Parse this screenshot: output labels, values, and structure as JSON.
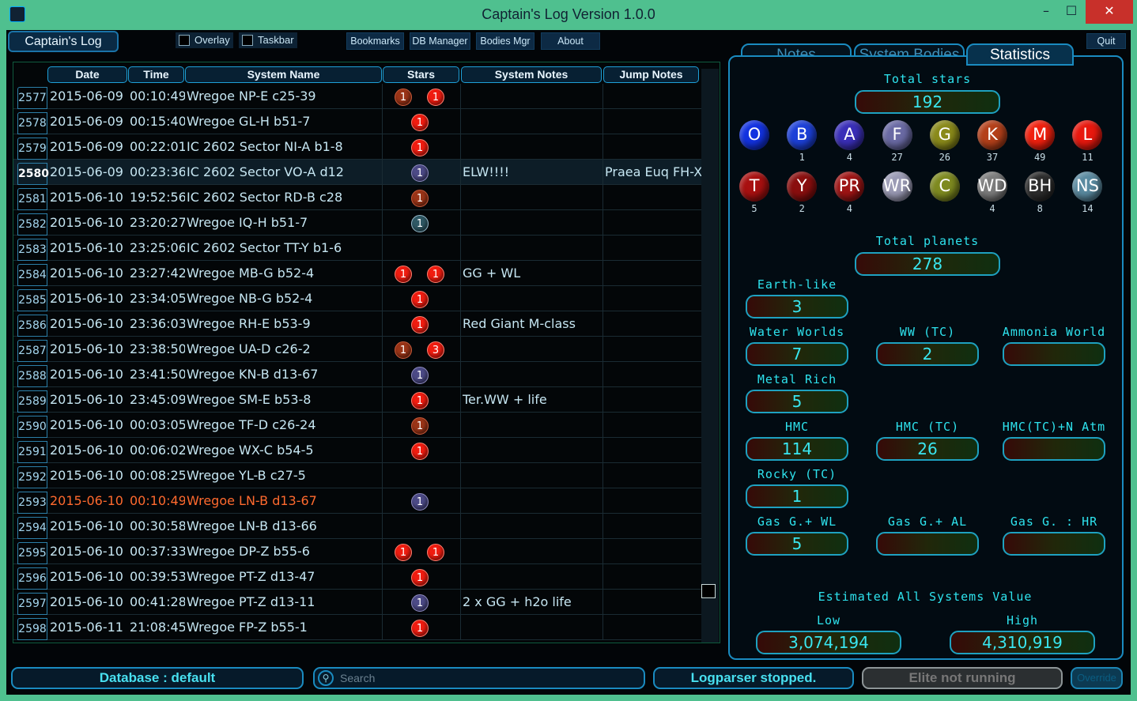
{
  "window": {
    "title": "Captain's Log Version 1.0.0",
    "min": "–",
    "max": "☐",
    "close": "✕"
  },
  "toolbar": {
    "app_label": "Captain's Log",
    "overlay": "Overlay",
    "taskbar": "Taskbar",
    "bookmarks": "Bookmarks",
    "db_manager": "DB Manager",
    "bodies_mgr": "Bodies Mgr",
    "about": "About",
    "quit": "Quit"
  },
  "grid": {
    "columns": [
      "Date",
      "Time",
      "System Name",
      "Stars",
      "System Notes",
      "Jump Notes"
    ],
    "rows": [
      {
        "id": "2577",
        "date": "2015-06-09",
        "time": "00:10:49",
        "name": "Wregoe NP-E c25-39",
        "stars": [
          {
            "n": "1",
            "c": "brown"
          },
          {
            "n": "1",
            "c": "red"
          }
        ],
        "notes": "",
        "jump": ""
      },
      {
        "id": "2578",
        "date": "2015-06-09",
        "time": "00:15:40",
        "name": "Wregoe GL-H b51-7",
        "stars": [
          {
            "n": "1",
            "c": "red"
          }
        ],
        "notes": "",
        "jump": ""
      },
      {
        "id": "2579",
        "date": "2015-06-09",
        "time": "00:22:01",
        "name": "IC 2602 Sector NI-A b1-8",
        "stars": [
          {
            "n": "1",
            "c": "red"
          }
        ],
        "notes": "",
        "jump": ""
      },
      {
        "id": "2580",
        "date": "2015-06-09",
        "time": "00:23:36",
        "name": "IC 2602 Sector VO-A d12",
        "stars": [
          {
            "n": "1",
            "c": "violet"
          }
        ],
        "notes": "ELW!!!!",
        "jump": "Praea Euq FH-X"
      },
      {
        "id": "2581",
        "date": "2015-06-10",
        "time": "19:52:56",
        "name": "IC 2602 Sector RD-B c28",
        "stars": [
          {
            "n": "1",
            "c": "brown"
          }
        ],
        "notes": "",
        "jump": ""
      },
      {
        "id": "2582",
        "date": "2015-06-10",
        "time": "23:20:27",
        "name": "Wregoe IQ-H b51-7",
        "stars": [
          {
            "n": "1",
            "c": "teal"
          }
        ],
        "notes": "",
        "jump": ""
      },
      {
        "id": "2583",
        "date": "2015-06-10",
        "time": "23:25:06",
        "name": "IC 2602 Sector TT-Y b1-6",
        "stars": [],
        "notes": "",
        "jump": ""
      },
      {
        "id": "2584",
        "date": "2015-06-10",
        "time": "23:27:42",
        "name": "Wregoe MB-G b52-4",
        "stars": [
          {
            "n": "1",
            "c": "red"
          },
          {
            "n": "1",
            "c": "red"
          }
        ],
        "notes": "GG + WL",
        "jump": ""
      },
      {
        "id": "2585",
        "date": "2015-06-10",
        "time": "23:34:05",
        "name": "Wregoe NB-G b52-4",
        "stars": [
          {
            "n": "1",
            "c": "red"
          }
        ],
        "notes": "",
        "jump": ""
      },
      {
        "id": "2586",
        "date": "2015-06-10",
        "time": "23:36:03",
        "name": "Wregoe RH-E b53-9",
        "stars": [
          {
            "n": "1",
            "c": "red"
          }
        ],
        "notes": "Red Giant M-class",
        "jump": ""
      },
      {
        "id": "2587",
        "date": "2015-06-10",
        "time": "23:38:50",
        "name": "Wregoe UA-D c26-2",
        "stars": [
          {
            "n": "1",
            "c": "brown"
          },
          {
            "n": "3",
            "c": "red"
          }
        ],
        "notes": "",
        "jump": ""
      },
      {
        "id": "2588",
        "date": "2015-06-10",
        "time": "23:41:50",
        "name": "Wregoe KN-B d13-67",
        "stars": [
          {
            "n": "1",
            "c": "violet"
          }
        ],
        "notes": "",
        "jump": ""
      },
      {
        "id": "2589",
        "date": "2015-06-10",
        "time": "23:45:09",
        "name": "Wregoe SM-E b53-8",
        "stars": [
          {
            "n": "1",
            "c": "red"
          }
        ],
        "notes": "Ter.WW + life",
        "jump": ""
      },
      {
        "id": "2590",
        "date": "2015-06-10",
        "time": "00:03:05",
        "name": "Wregoe TF-D c26-24",
        "stars": [
          {
            "n": "1",
            "c": "brown"
          }
        ],
        "notes": "",
        "jump": ""
      },
      {
        "id": "2591",
        "date": "2015-06-10",
        "time": "00:06:02",
        "name": "Wregoe WX-C b54-5",
        "stars": [
          {
            "n": "1",
            "c": "red"
          }
        ],
        "notes": "",
        "jump": ""
      },
      {
        "id": "2592",
        "date": "2015-06-10",
        "time": "00:08:25",
        "name": "Wregoe YL-B c27-5",
        "stars": [],
        "notes": "",
        "jump": ""
      },
      {
        "id": "2593",
        "date": "2015-06-10",
        "time": "00:10:49",
        "name": "Wregoe LN-B d13-67",
        "stars": [
          {
            "n": "1",
            "c": "violet"
          }
        ],
        "notes": "",
        "jump": "",
        "alert": true
      },
      {
        "id": "2594",
        "date": "2015-06-10",
        "time": "00:30:58",
        "name": "Wregoe LN-B d13-66",
        "stars": [],
        "notes": "",
        "jump": ""
      },
      {
        "id": "2595",
        "date": "2015-06-10",
        "time": "00:37:33",
        "name": "Wregoe DP-Z b55-6",
        "stars": [
          {
            "n": "1",
            "c": "red"
          },
          {
            "n": "1",
            "c": "red"
          }
        ],
        "notes": "",
        "jump": ""
      },
      {
        "id": "2596",
        "date": "2015-06-10",
        "time": "00:39:53",
        "name": "Wregoe PT-Z d13-47",
        "stars": [
          {
            "n": "1",
            "c": "red"
          }
        ],
        "notes": "",
        "jump": ""
      },
      {
        "id": "2597",
        "date": "2015-06-10",
        "time": "00:41:28",
        "name": "Wregoe PT-Z d13-11",
        "stars": [
          {
            "n": "1",
            "c": "violet"
          }
        ],
        "notes": "2 x GG + h2o life",
        "jump": ""
      },
      {
        "id": "2598",
        "date": "2015-06-11",
        "time": "21:08:45",
        "name": "Wregoe FP-Z b55-1",
        "stars": [
          {
            "n": "1",
            "c": "red"
          }
        ],
        "notes": "",
        "jump": ""
      }
    ]
  },
  "tabs": {
    "notes": "Notes",
    "bodies": "System Bodies",
    "stats": "Statistics"
  },
  "stats": {
    "total_stars_label": "Total stars",
    "total_stars": "192",
    "star_classes": [
      {
        "cls": "O",
        "count": "",
        "color": "#1232e0"
      },
      {
        "cls": "B",
        "count": "1",
        "color": "#1c40d8"
      },
      {
        "cls": "A",
        "count": "4",
        "color": "#3a2fb8"
      },
      {
        "cls": "F",
        "count": "27",
        "color": "#6a6aa4"
      },
      {
        "cls": "G",
        "count": "26",
        "color": "#8a8a1a"
      },
      {
        "cls": "K",
        "count": "37",
        "color": "#b4401a"
      },
      {
        "cls": "M",
        "count": "49",
        "color": "#f0200e"
      },
      {
        "cls": "L",
        "count": "11",
        "color": "#e8180e"
      },
      {
        "cls": "T",
        "count": "5",
        "color": "#a81010"
      },
      {
        "cls": "Y",
        "count": "2",
        "color": "#8a0e0e"
      },
      {
        "cls": "PR",
        "count": "4",
        "color": "#9e1414"
      },
      {
        "cls": "WR",
        "count": "",
        "color": "#9a9ab4"
      },
      {
        "cls": "C",
        "count": "",
        "color": "#7e8a20"
      },
      {
        "cls": "WD",
        "count": "4",
        "color": "#7c7c7c"
      },
      {
        "cls": "BH",
        "count": "8",
        "color": "#2c2c2c"
      },
      {
        "cls": "NS",
        "count": "14",
        "color": "#5a8aa0"
      }
    ],
    "total_planets_label": "Total planets",
    "total_planets": "278",
    "planets": [
      {
        "label": "Earth-like",
        "value": "3"
      },
      {
        "label": "Water Worlds",
        "value": "7"
      },
      {
        "label": "WW (TC)",
        "value": "2"
      },
      {
        "label": "Ammonia World",
        "value": ""
      },
      {
        "label": "Metal Rich",
        "value": "5"
      },
      {
        "label": "HMC",
        "value": "114"
      },
      {
        "label": "HMC (TC)",
        "value": "26"
      },
      {
        "label": "HMC(TC)+N Atm",
        "value": ""
      },
      {
        "label": "Rocky (TC)",
        "value": "1"
      },
      {
        "label": "Gas G.+ WL",
        "value": "5"
      },
      {
        "label": "Gas G.+ AL",
        "value": ""
      },
      {
        "label": "Gas G. : HR",
        "value": ""
      }
    ],
    "estimate_label": "Estimated All Systems Value",
    "low_label": "Low",
    "high_label": "High",
    "low": "3,074,194",
    "high": "4,310,919"
  },
  "status": {
    "database": "Database : default",
    "search_placeholder": "Search",
    "logparser": "Logparser stopped.",
    "elite": "Elite not running",
    "override": "Override"
  }
}
